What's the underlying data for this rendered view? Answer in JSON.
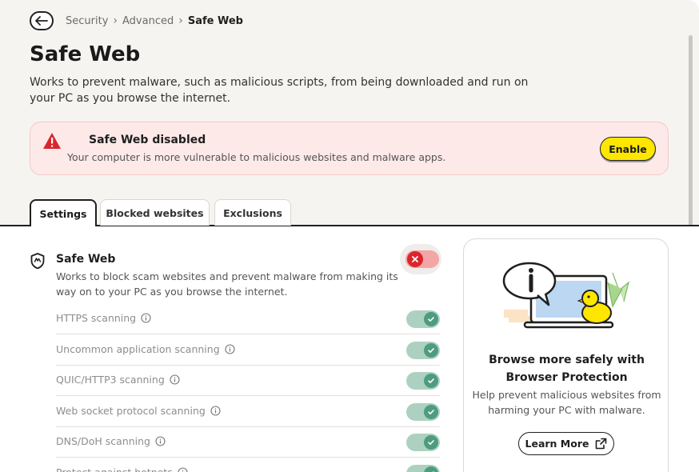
{
  "breadcrumb": {
    "items": [
      "Security",
      "Advanced"
    ],
    "current": "Safe Web"
  },
  "page": {
    "title": "Safe Web",
    "description": "Works to prevent malware, such as malicious scripts, from being downloaded and run on your PC as you browse the internet."
  },
  "alert": {
    "title": "Safe Web disabled",
    "text": "Your computer is more vulnerable to malicious websites and malware apps.",
    "button_label": "Enable",
    "icon": "warning-icon",
    "color": "#d9262c"
  },
  "tabs": [
    {
      "label": "Settings",
      "active": true
    },
    {
      "label": "Blocked websites",
      "active": false
    },
    {
      "label": "Exclusions",
      "active": false
    }
  ],
  "safe_web": {
    "title": "Safe Web",
    "description": "Works to block scam websites and prevent malware from making its way on to your PC as you browse the internet.",
    "enabled": false
  },
  "settings": [
    {
      "label": "HTTPS scanning",
      "enabled": true
    },
    {
      "label": "Uncommon application scanning",
      "enabled": true
    },
    {
      "label": "QUIC/HTTP3 scanning",
      "enabled": true
    },
    {
      "label": "Web socket protocol scanning",
      "enabled": true
    },
    {
      "label": "DNS/DoH scanning",
      "enabled": true
    },
    {
      "label": "Protect against botnets",
      "enabled": true
    }
  ],
  "promo": {
    "title": "Browse more safely with Browser Protection",
    "text": "Help prevent malicious websites from harming your PC with malware.",
    "button_label": "Learn More"
  },
  "colors": {
    "accent_yellow": "#ffe600",
    "toggle_on": "#2e8b6a",
    "toggle_off": "#d9262c"
  }
}
